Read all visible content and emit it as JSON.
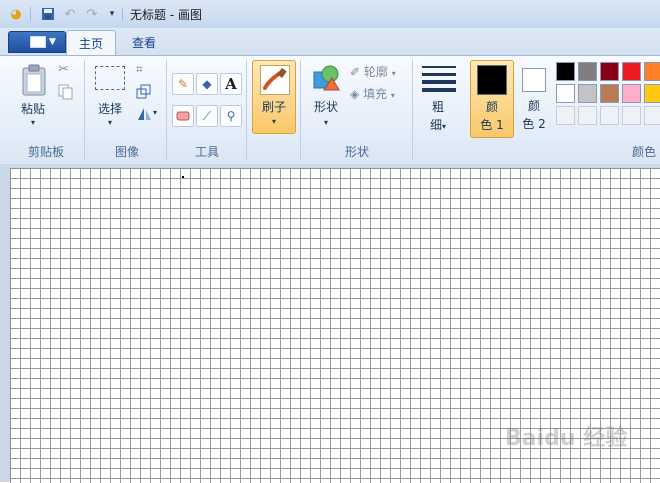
{
  "window": {
    "title": "无标题 - 画图"
  },
  "quick_access": {
    "icons": [
      "paint-app-icon",
      "save-icon",
      "undo-icon",
      "redo-icon",
      "customize-dropdown-icon"
    ]
  },
  "tabs": [
    {
      "label": "主页"
    },
    {
      "label": "查看"
    }
  ],
  "ribbon": {
    "clipboard": {
      "paste_label": "粘贴",
      "group_label": "剪贴板"
    },
    "image": {
      "select_label": "选择",
      "group_label": "图像"
    },
    "tools": {
      "group_label": "工具",
      "text_glyph": "A"
    },
    "brushes": {
      "label": "刷子"
    },
    "shapes": {
      "label": "形状",
      "outline_label": "轮廓",
      "fill_label": "填充",
      "group_label": "形状"
    },
    "size": {
      "label_line1": "粗",
      "label_line2": "细"
    },
    "color1": {
      "label_line1": "颜",
      "label_line2": "色 1",
      "value": "#000000"
    },
    "color2": {
      "label_line1": "颜",
      "label_line2": "色 2",
      "value": "#ffffff"
    },
    "colors": {
      "group_label": "颜色",
      "row1": [
        "#000000",
        "#7f7f7f",
        "#880015",
        "#ed1c24",
        "#ff7f27"
      ],
      "row2": [
        "#ffffff",
        "#c3c3c3",
        "#b97a57",
        "#ffaec9",
        "#ffc90e"
      ]
    }
  },
  "watermark": "Baidu 经验"
}
